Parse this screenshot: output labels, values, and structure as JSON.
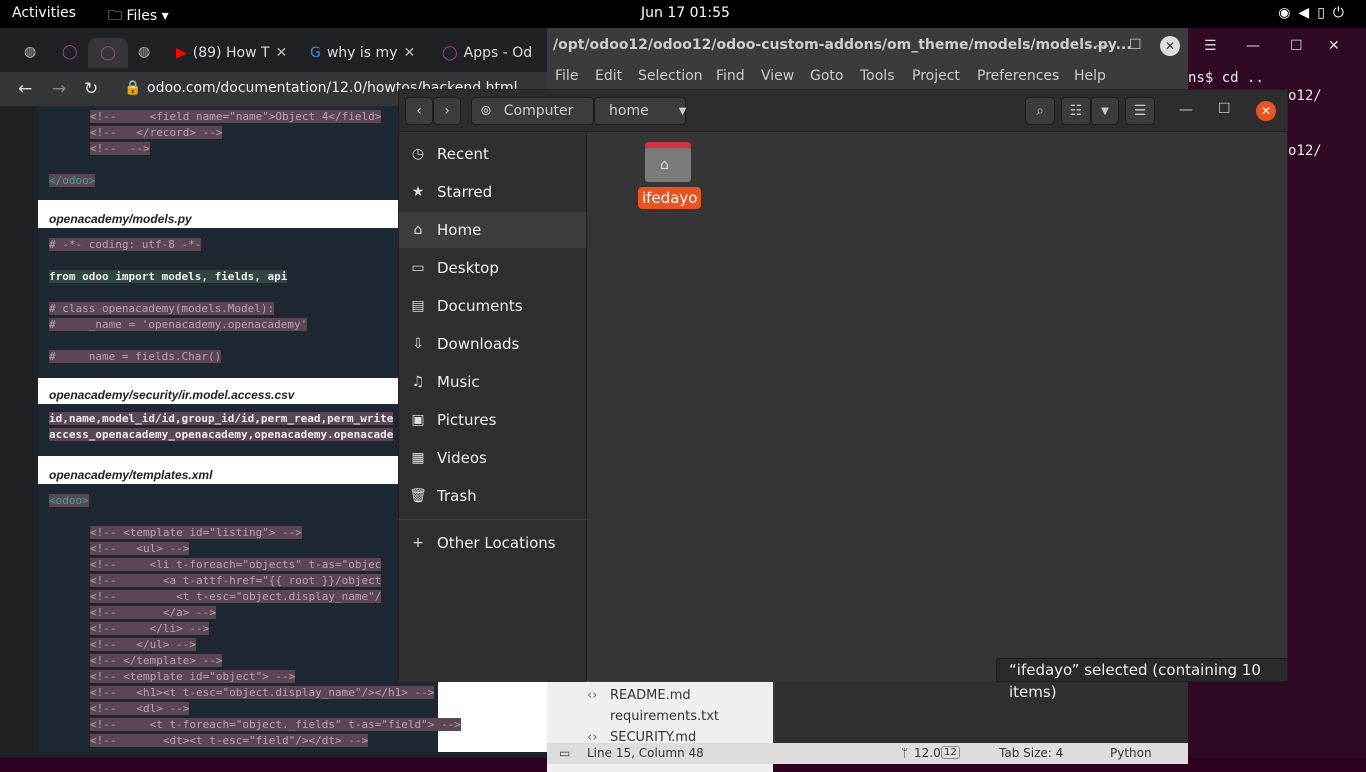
{
  "topbar": {
    "activities": "Activities",
    "app_menu": "Files",
    "clock": "Jun 17  01:55",
    "tray_icons": [
      "wifi-icon",
      "volume-icon",
      "battery-icon",
      "power-icon"
    ]
  },
  "browser": {
    "tabs": [
      {
        "label": "(89) How T"
      },
      {
        "label": "why is my"
      },
      {
        "label": "Apps - Od"
      }
    ],
    "url": "odoo.com/documentation/12.0/howtos/backend.html",
    "code1": [
      "<!--     <field name=\"name\">Object 4</field>",
      "<!--   </record> -->",
      "<!--  -->",
      "</odoo>"
    ],
    "file1": "openacademy/models.py",
    "code2": [
      "# -*- coding: utf-8 -*-",
      "from odoo import models, fields, api",
      "# class openacademy(models.Model):",
      "#     _name = 'openacademy.openacademy'",
      "#     name = fields.Char()"
    ],
    "file2": "openacademy/security/ir.model.access.csv",
    "code3": [
      "id,name,model_id/id,group_id/id,perm_read,perm_write",
      "access_openacademy_openacademy,openacademy.openacade"
    ],
    "file3": "openacademy/templates.xml",
    "code4": [
      "<odoo>",
      "<!-- <template id=\"listing\"> -->",
      "<!--   <ul> -->",
      "<!--     <li t-foreach=\"objects\" t-as=\"objec",
      "<!--       <a t-attf-href=\"{{ root }}/object",
      "<!--         <t t-esc=\"object.display_name\"/",
      "<!--       </a> -->",
      "<!--     </li> -->",
      "<!--   </ul> -->",
      "<!-- </template> -->",
      "<!-- <template id=\"object\"> -->",
      "<!--   <h1><t t-esc=\"object.display_name\"/></h1> -->",
      "<!--   <dl> -->",
      "<!--     <t t-foreach=\"object._fields\" t-as=\"field\"> -->",
      "<!--       <dt><t t-esc=\"field\"/></dt> -->"
    ]
  },
  "terminal": {
    "lines": [
      "ns$ cd ..",
      "o12/",
      "o12/"
    ]
  },
  "editor": {
    "title": "/opt/odoo12/odoo12/odoo-custom-addons/om_theme/models/models.py...",
    "menu": [
      "File",
      "Edit",
      "Selection",
      "Find",
      "View",
      "Goto",
      "Tools",
      "Project",
      "Preferences",
      "Help"
    ],
    "tree": [
      "README.md",
      "requirements.txt",
      "SECURITY.md"
    ],
    "status": {
      "position": "Line 15, Column 48",
      "branch": "12.0",
      "branch_badge": "12",
      "tab_size": "Tab Size: 4",
      "syntax": "Python"
    }
  },
  "files": {
    "path": [
      "Computer",
      "home"
    ],
    "sidebar": [
      {
        "label": "Recent",
        "icon": "clock-icon"
      },
      {
        "label": "Starred",
        "icon": "star-icon"
      },
      {
        "label": "Home",
        "icon": "home-icon"
      },
      {
        "label": "Desktop",
        "icon": "desktop-icon"
      },
      {
        "label": "Documents",
        "icon": "document-icon"
      },
      {
        "label": "Downloads",
        "icon": "download-icon"
      },
      {
        "label": "Music",
        "icon": "music-icon"
      },
      {
        "label": "Pictures",
        "icon": "picture-icon"
      },
      {
        "label": "Videos",
        "icon": "video-icon"
      },
      {
        "label": "Trash",
        "icon": "trash-icon"
      }
    ],
    "other_locations": "Other Locations",
    "folder": "ifedayo",
    "status": "“ifedayo” selected  (containing 10 items)"
  }
}
